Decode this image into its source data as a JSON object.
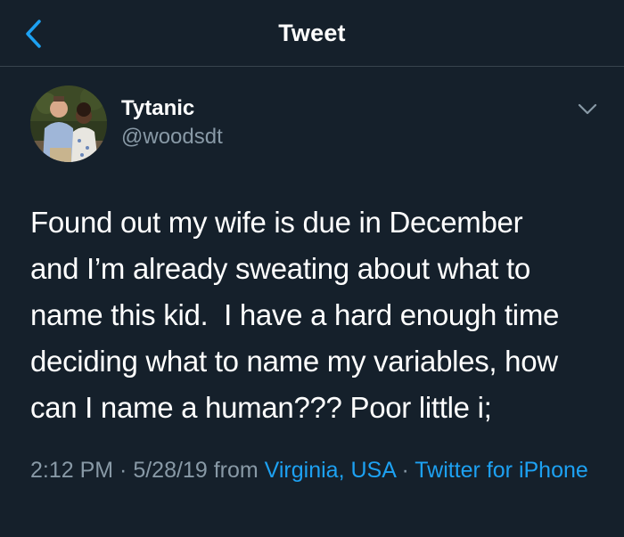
{
  "header": {
    "title": "Tweet",
    "back_icon": "chevron-left-icon"
  },
  "author": {
    "display_name": "Tytanic",
    "handle": "@woodsdt",
    "menu_icon": "chevron-down-icon"
  },
  "tweet": {
    "text": "Found out my wife is due in December\nand I’m already sweating about what to\nname this kid.  I have a hard enough time\ndeciding what to name my variables, how\ncan I name a human??? Poor little i;"
  },
  "meta": {
    "time": "2:12 PM",
    "sep1": " · ",
    "date": "5/28/19",
    "from_word": " from ",
    "location": "Virginia, USA",
    "sep2": " · ",
    "source": "Twitter for iPhone"
  },
  "colors": {
    "background": "#15202b",
    "accent": "#1da1f2",
    "secondary_text": "#8899a6",
    "divider": "#38444d"
  }
}
